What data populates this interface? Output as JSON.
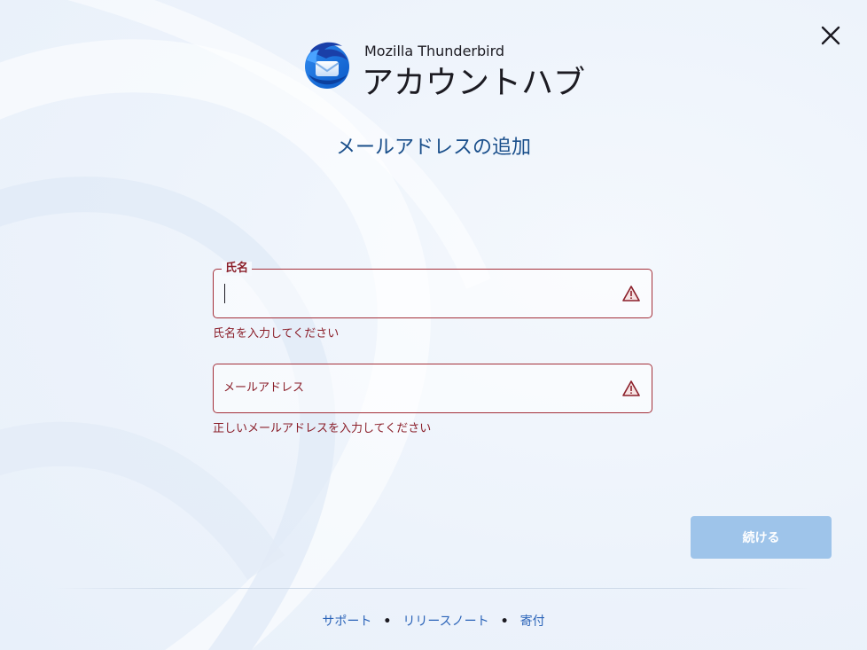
{
  "header": {
    "app_name": "Mozilla Thunderbird",
    "title": "アカウントハブ",
    "close_icon": "close-icon",
    "logo_icon": "thunderbird-logo"
  },
  "main": {
    "heading": "メールアドレスの追加",
    "fields": [
      {
        "label": "氏名",
        "value": "",
        "placeholder": "",
        "error": "氏名を入力してください",
        "icon": "warning-icon"
      },
      {
        "label": "",
        "value": "",
        "placeholder": "メールアドレス",
        "error": "正しいメールアドレスを入力してください",
        "icon": "warning-icon"
      }
    ],
    "continue_label": "続ける"
  },
  "footer": {
    "links": [
      "サポート",
      "リリースノート",
      "寄付"
    ],
    "separator": "•"
  },
  "colors": {
    "error": "#8b1f2a",
    "error_border": "#a4303a",
    "button_disabled": "#9ec4ea",
    "heading": "#1a4f8b",
    "link": "#2a63b8"
  }
}
